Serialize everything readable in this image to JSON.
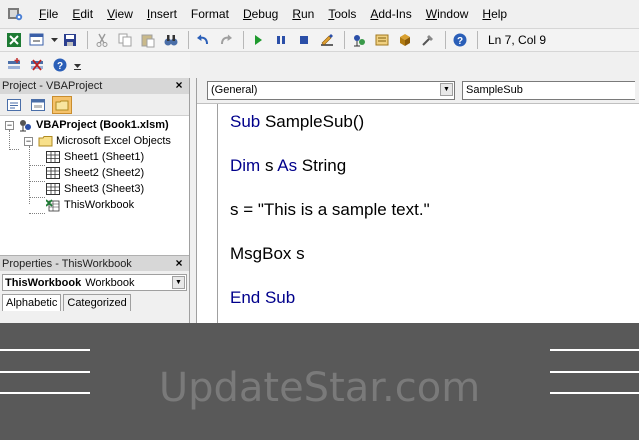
{
  "menu": {
    "items": [
      {
        "label": "File",
        "mnemonic": "F",
        "rest": "ile"
      },
      {
        "label": "Edit",
        "mnemonic": "E",
        "rest": "dit"
      },
      {
        "label": "View",
        "mnemonic": "V",
        "rest": "iew"
      },
      {
        "label": "Insert",
        "mnemonic": "I",
        "rest": "nsert"
      },
      {
        "label": "Format",
        "mnemonic": "F",
        "rest": "ormat"
      },
      {
        "label": "Debug",
        "mnemonic": "D",
        "rest": "ebug"
      },
      {
        "label": "Run",
        "mnemonic": "R",
        "rest": "un"
      },
      {
        "label": "Tools",
        "mnemonic": "T",
        "rest": "ools"
      },
      {
        "label": "Add-Ins",
        "mnemonic": "A",
        "rest": "dd-Ins"
      },
      {
        "label": "Window",
        "mnemonic": "W",
        "rest": "indow"
      },
      {
        "label": "Help",
        "mnemonic": "H",
        "rest": "elp"
      }
    ]
  },
  "toolbar": {
    "status": "Ln 7, Col 9"
  },
  "project": {
    "title": "Project - VBAProject",
    "close": "×",
    "root": "VBAProject (Book1.xlsm)",
    "folder": "Microsoft Excel Objects",
    "items": [
      "Sheet1 (Sheet1)",
      "Sheet2 (Sheet2)",
      "Sheet3 (Sheet3)",
      "ThisWorkbook"
    ]
  },
  "properties": {
    "title": "Properties - ThisWorkbook",
    "close": "×",
    "object_name": "ThisWorkbook",
    "object_type": "Workbook",
    "tabs": [
      "Alphabetic",
      "Categorized"
    ]
  },
  "code": {
    "object_combo": "(General)",
    "proc_combo": "SampleSub",
    "lines": [
      {
        "kw": "Sub",
        "text": " SampleSub()"
      },
      {
        "kw": "Dim",
        "text": " s ",
        "kw2": "As",
        "text2": " String"
      },
      {
        "kw": "",
        "text": "s = \"This is a sample text.\""
      },
      {
        "kw": "",
        "text": "MsgBox s"
      },
      {
        "kw": "End Sub",
        "text": ""
      }
    ]
  },
  "banner": {
    "brand": "UpdateStar.com"
  },
  "colors": {
    "keyword": "#00008b",
    "banner_bg": "#595959",
    "brand_text": "#7a7a7a"
  }
}
